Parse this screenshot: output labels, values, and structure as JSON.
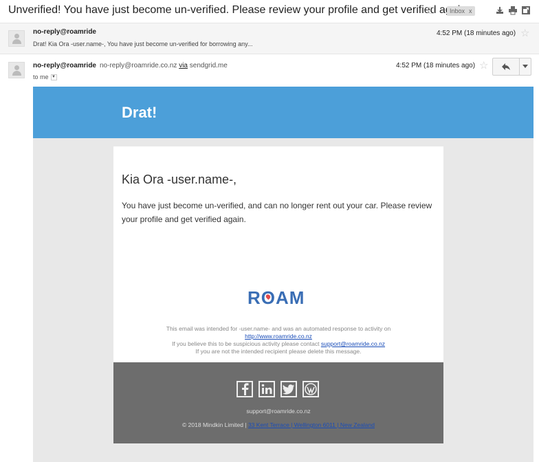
{
  "subject": {
    "title": "Unverified! You have just become un-verified. Please review your profile and get verified again.",
    "label": "Inbox",
    "label_remove": "x",
    "icons": [
      "print-download-icon",
      "print-icon",
      "new-window-icon"
    ]
  },
  "message_collapsed": {
    "sender": "no-reply@roamride",
    "snippet": "Drat! Kia Ora -user.name-, You have just become un-verified for borrowing any...",
    "time": "4:52 PM (18 minutes ago)"
  },
  "message_expanded": {
    "sender": "no-reply@roamride",
    "sender_email": "no-reply@roamride.co.nz",
    "via_label": "via",
    "via_domain": "sendgrid.me",
    "to": "to me",
    "time": "4:52 PM (18 minutes ago)"
  },
  "email": {
    "banner_title": "Drat!",
    "greeting": "Kia Ora -user.name-,",
    "body": "You have just become un-verified, and can no longer rent out your car. Please review your profile and get verified again.",
    "logo_text": "ROAM",
    "fine_print": {
      "line1": "This email was intended for -user.name- and was an automated response to activity on",
      "link1": "http://www.roamride.co.nz",
      "line2_prefix": "If you believe this to be suspicious activity please contact",
      "link2": "support@roamride.co.nz",
      "line3": "If you are not the intended recipient please delete this message."
    },
    "footer": {
      "social": [
        "facebook-icon",
        "linkedin-icon",
        "twitter-icon",
        "wordpress-icon"
      ],
      "support_email": "support@roamride.co.nz",
      "copyright_prefix": "© 2018 Mindkin Limited |",
      "address": "33 Kent Terrace | Wellington 6011 | New Zealand"
    }
  }
}
